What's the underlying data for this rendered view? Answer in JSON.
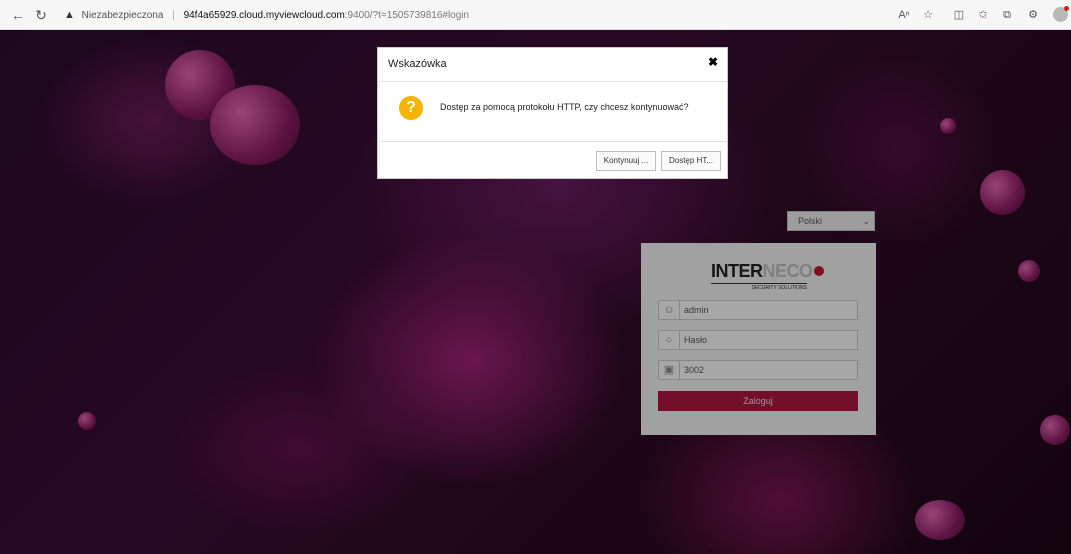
{
  "browser": {
    "warning_label": "Niezabezpieczona",
    "separator": "|",
    "url_host": "94f4a65929.cloud.myviewcloud.com",
    "url_rest": ":9400/?t=1505739816#login"
  },
  "language": {
    "selected": "Polski"
  },
  "login": {
    "logo_main": "INTER",
    "logo_accent": "NECO",
    "logo_sub": "SECURITY SOLUTIONS",
    "username_value": "admin",
    "password_placeholder": "Hasło",
    "port_value": "3002",
    "login_label": "Zaloguj"
  },
  "dialog": {
    "title": "Wskazówka",
    "message": "Dostęp za pomocą protokołu HTTP, czy chcesz kontynuować?",
    "continue_label": "Kontynuuj ...",
    "http_label": "Dostęp HT..."
  }
}
